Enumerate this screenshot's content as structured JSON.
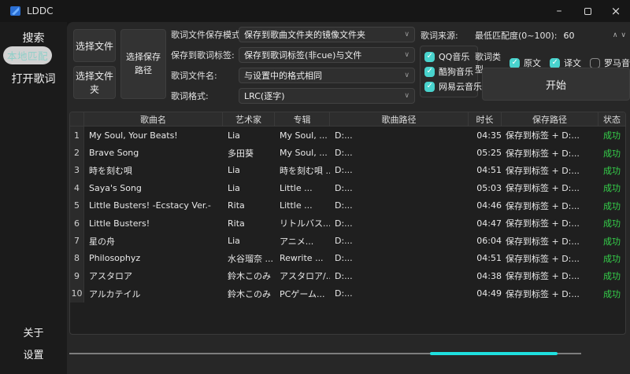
{
  "colors": {
    "accent_teal": "#49d3cd",
    "progress_cyan": "#1fe0df",
    "status_green": "#35d14a",
    "selected_pill_bg": "#d2d2d2"
  },
  "titlebar": {
    "title": "LDDC"
  },
  "sidebar": {
    "items": [
      {
        "label": "搜索",
        "active": false
      },
      {
        "label": "本地匹配",
        "active": true
      },
      {
        "label": "打开歌词",
        "active": false
      }
    ],
    "bottom_items": [
      {
        "label": "关于"
      },
      {
        "label": "设置"
      }
    ]
  },
  "toolbar": {
    "select_file": "选择文件",
    "select_folder": "选择文件夹",
    "select_save_path": "选择保存路径"
  },
  "form": {
    "rows": [
      {
        "label": "歌词文件保存模式:",
        "value": "保存到歌曲文件夹的镜像文件夹"
      },
      {
        "label": "保存到歌词标签:",
        "value": "保存到歌词标签(非cue)与文件"
      },
      {
        "label": "歌词文件名:",
        "value": "与设置中的格式相同"
      },
      {
        "label": "歌词格式:",
        "value": "LRC(逐字)"
      }
    ]
  },
  "source": {
    "label": "歌词来源:",
    "options": [
      {
        "label": "QQ音乐",
        "checked": true
      },
      {
        "label": "酷狗音乐",
        "checked": true
      },
      {
        "label": "网易云音乐",
        "checked": true
      }
    ]
  },
  "match": {
    "label": "最低匹配度(0~100):",
    "value": "60"
  },
  "lyric_type": {
    "label": "歌词类型:",
    "options": [
      {
        "label": "原文",
        "checked": true
      },
      {
        "label": "译文",
        "checked": true
      },
      {
        "label": "罗马音",
        "checked": false
      }
    ]
  },
  "start_button": "开始",
  "table": {
    "headers": {
      "num": "",
      "song": "歌曲名",
      "artist": "艺术家",
      "album": "专辑",
      "path": "歌曲路径",
      "duration": "时长",
      "save": "保存路径",
      "status": "状态"
    },
    "rows": [
      {
        "num": "1",
        "song": "My Soul, Your Beats!",
        "artist": "Lia",
        "album": "My Soul, ...",
        "path": "D:...",
        "duration": "04:35",
        "save": "保存到标签 + D:...",
        "status": "成功"
      },
      {
        "num": "2",
        "song": "Brave Song",
        "artist": "多田葵",
        "album": "My Soul, ...",
        "path": "D:...",
        "duration": "05:25",
        "save": "保存到标签 + D:...",
        "status": "成功"
      },
      {
        "num": "3",
        "song": "時を刻む唄",
        "artist": "Lia",
        "album": "時を刻む唄 ...",
        "path": "D:...",
        "duration": "04:51",
        "save": "保存到标签 + D:...",
        "status": "成功"
      },
      {
        "num": "4",
        "song": "Saya's Song",
        "artist": "Lia",
        "album": "Little ...",
        "path": "D:...",
        "duration": "05:03",
        "save": "保存到标签 + D:...",
        "status": "成功"
      },
      {
        "num": "5",
        "song": "Little Busters! -Ecstacy Ver.-",
        "artist": "Rita",
        "album": "Little ...",
        "path": "D:...",
        "duration": "04:46",
        "save": "保存到标签 + D:...",
        "status": "成功"
      },
      {
        "num": "6",
        "song": "Little Busters!",
        "artist": "Rita",
        "album": "リトルバス...",
        "path": "D:...",
        "duration": "04:47",
        "save": "保存到标签 + D:...",
        "status": "成功"
      },
      {
        "num": "7",
        "song": "星の舟",
        "artist": "Lia",
        "album": "アニメ...",
        "path": "D:...",
        "duration": "06:04",
        "save": "保存到标签 + D:...",
        "status": "成功"
      },
      {
        "num": "8",
        "song": "Philosophyz",
        "artist": "水谷瑠奈 ...",
        "album": "Rewrite ...",
        "path": "D:...",
        "duration": "04:51",
        "save": "保存到标签 + D:...",
        "status": "成功"
      },
      {
        "num": "9",
        "song": "アスタロア",
        "artist": "鈴木このみ",
        "album": "アスタロア/...",
        "path": "D:...",
        "duration": "04:38",
        "save": "保存到标签 + D:...",
        "status": "成功"
      },
      {
        "num": "10",
        "song": "アルカテイル",
        "artist": "鈴木このみ",
        "album": "PCゲーム...",
        "path": "D:...",
        "duration": "04:49",
        "save": "保存到标签 + D:...",
        "status": "成功"
      }
    ]
  }
}
